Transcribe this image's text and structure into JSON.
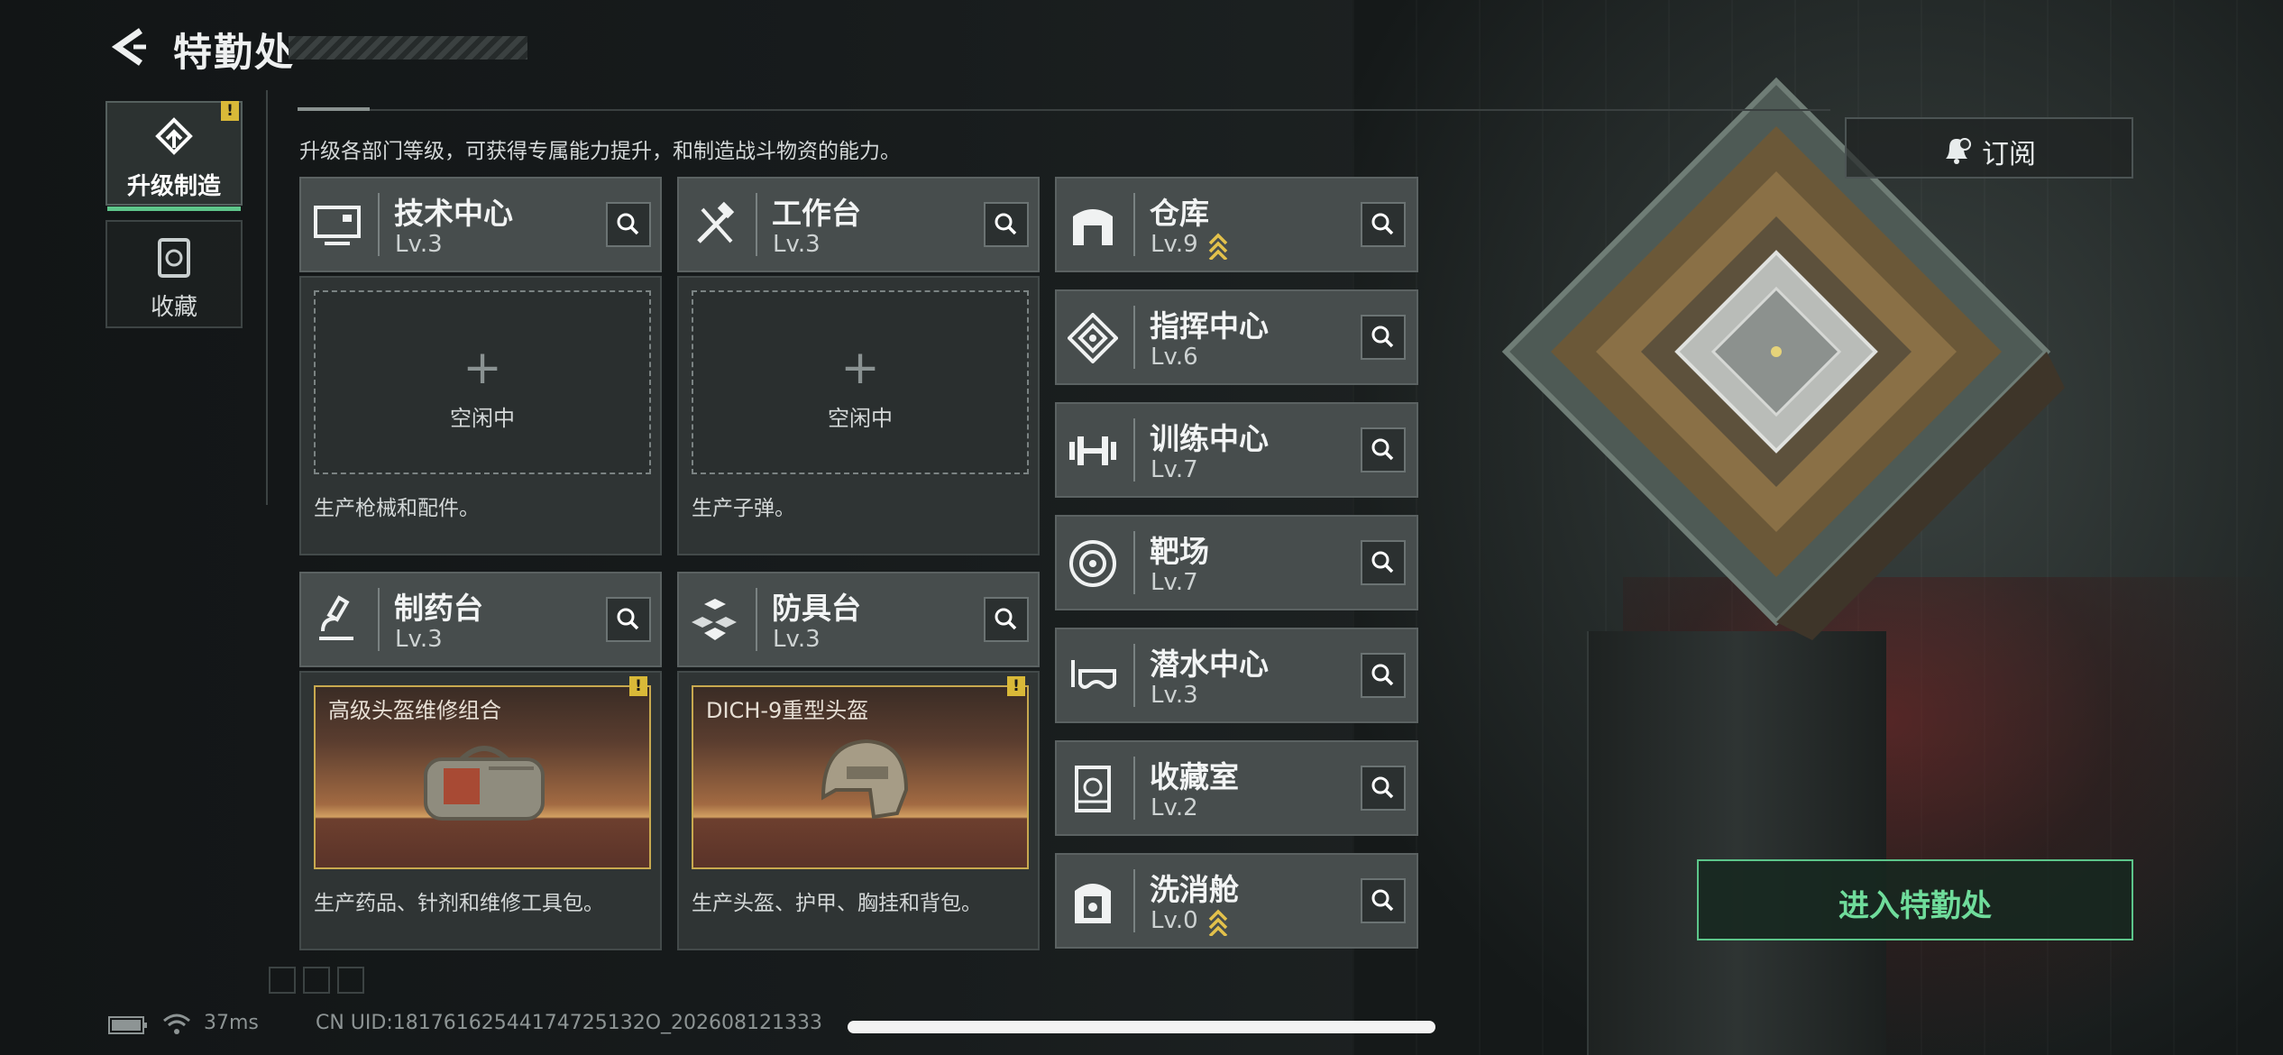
{
  "header": {
    "title": "特勤处"
  },
  "tabs": [
    {
      "label": "升级制造",
      "active": true,
      "badge": "!"
    },
    {
      "label": "收藏",
      "active": false
    }
  ],
  "instruction": "升级各部门等级，可获得专属能力提升，和制造战斗物资的能力。",
  "workshops": [
    {
      "name": "技术中心",
      "level": "Lv.3",
      "slot": "空闲中",
      "plus": "+",
      "desc": "生产枪械和配件。"
    },
    {
      "name": "工作台",
      "level": "Lv.3",
      "slot": "空闲中",
      "plus": "+",
      "desc": "生产子弹。"
    },
    {
      "name": "制药台",
      "level": "Lv.3",
      "item": "高级头盔维修组合",
      "badge": "!",
      "desc": "生产药品、针剂和维修工具包。"
    },
    {
      "name": "防具台",
      "level": "Lv.3",
      "item": "DICH-9重型头盔",
      "badge": "!",
      "desc": "生产头盔、护甲、胸挂和背包。"
    }
  ],
  "departments": [
    {
      "name": "仓库",
      "level": "Lv.9",
      "upgrade": true
    },
    {
      "name": "指挥中心",
      "level": "Lv.6",
      "upgrade": false
    },
    {
      "name": "训练中心",
      "level": "Lv.7",
      "upgrade": false
    },
    {
      "name": "靶场",
      "level": "Lv.7",
      "upgrade": false
    },
    {
      "name": "潜水中心",
      "level": "Lv.3",
      "upgrade": false
    },
    {
      "name": "收藏室",
      "level": "Lv.2",
      "upgrade": false
    },
    {
      "name": "洗消舱",
      "level": "Lv.0",
      "upgrade": true
    }
  ],
  "buttons": {
    "subscribe": "订阅",
    "enter": "进入特勤处"
  },
  "status": {
    "ping": "37ms",
    "uid": "CN UID:18176162544174725132O_202608121333"
  },
  "colors": {
    "accent_green": "#5ec58a",
    "badge_yellow": "#d9b938",
    "item_border": "#c8a94f"
  }
}
